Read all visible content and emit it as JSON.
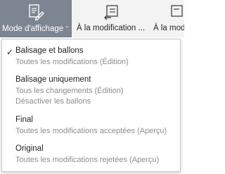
{
  "ribbon": {
    "buttons": [
      {
        "label": "Mode d'affichage",
        "caret": "⌃",
        "icon": "view-mode-icon",
        "active": true
      },
      {
        "label": "À la modification ...",
        "icon": "previous-change-icon"
      },
      {
        "label": "À la modification",
        "icon": "next-change-icon"
      }
    ]
  },
  "menu": {
    "items": [
      {
        "title": "Balisage et ballons",
        "lines": [
          "Toutes les modifications (Édition)"
        ],
        "checked": true,
        "check_glyph": "✓"
      },
      {
        "title": "Balisage uniquement",
        "lines": [
          "Tous les changements (Édition)",
          "Désactiver les ballons"
        ],
        "checked": false
      },
      {
        "title": "Final",
        "lines": [
          "Toutes les modifications acceptées (Aperçu)"
        ],
        "checked": false
      },
      {
        "title": "Original",
        "lines": [
          "Toutes les modifications rejetées (Aperçu)"
        ],
        "checked": false
      }
    ]
  },
  "colors": {
    "active_button_bg": "#7d8592",
    "ribbon_bg": "#f3f3f3",
    "secondary_text": "#8d8d8d"
  }
}
